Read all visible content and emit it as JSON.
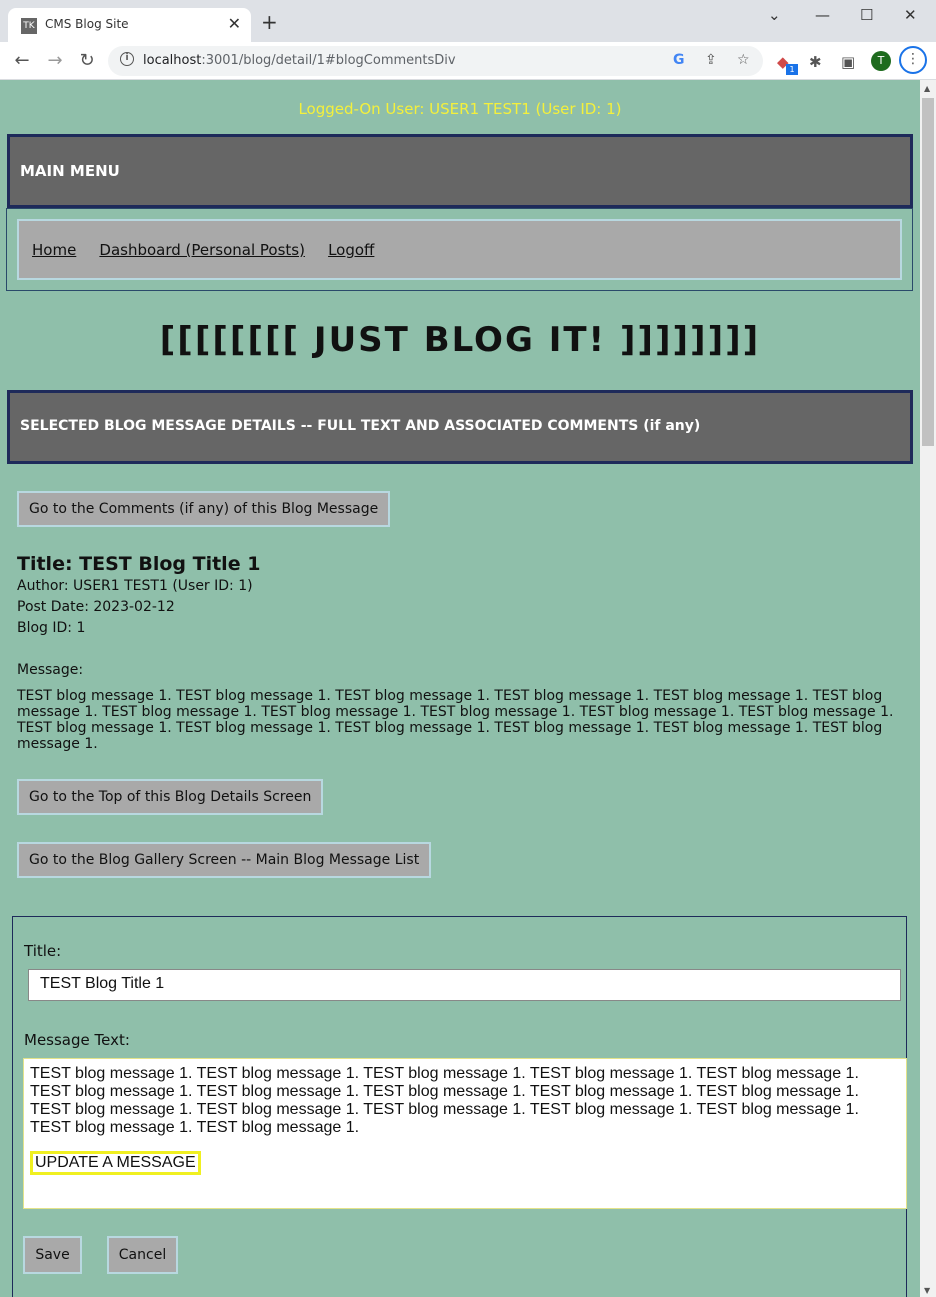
{
  "browser": {
    "tab_favicon": "TK",
    "tab_title": "CMS Blog Site",
    "tab_close": "✕",
    "new_tab": "+",
    "url_host": "localhost",
    "url_rest": ":3001/blog/detail/1#blogCommentsDiv",
    "window_minimize": "⌄",
    "profile_initial": "T",
    "extension_badge": "1"
  },
  "page": {
    "logged_user": "Logged-On User: USER1 TEST1 (User ID: 1)",
    "main_menu": "MAIN MENU",
    "nav": [
      {
        "label": "Home"
      },
      {
        "label": "Dashboard (Personal Posts)"
      },
      {
        "label": "Logoff"
      }
    ],
    "site_title": "[[[[[[[[   JUST   BLOG IT!   ]]]]]]]]",
    "detail_header": "SELECTED BLOG MESSAGE DETAILS -- FULL TEXT AND ASSOCIATED COMMENTS (if any)",
    "btn_comments": "Go to the Comments (if any) of this Blog Message",
    "blog_title": "Title: TEST Blog Title 1",
    "author": "Author: USER1 TEST1 (User ID: 1)",
    "post_date": "Post Date: 2023-02-12",
    "blog_id": "Blog ID: 1",
    "message_label": "Message:",
    "message_text": "TEST blog message 1. TEST blog message 1. TEST blog message 1. TEST blog message 1. TEST blog message 1. TEST blog message 1. TEST blog message 1. TEST blog message 1. TEST blog message 1. TEST blog message 1. TEST blog message 1. TEST blog message 1. TEST blog message 1. TEST blog message 1. TEST blog message 1. TEST blog message 1. TEST blog message 1.",
    "btn_top": "Go to the Top of this Blog Details Screen",
    "btn_gallery": "Go to the Blog Gallery Screen -- Main Blog Message List",
    "form": {
      "title_label": "Title:",
      "title_value": "TEST Blog Title 1",
      "message_label": "Message Text:",
      "message_value": "TEST blog message 1. TEST blog message 1. TEST blog message 1. TEST blog message 1. TEST blog message 1. TEST blog message 1. TEST blog message 1. TEST blog message 1. TEST blog message 1. TEST blog message 1. TEST blog message 1. TEST blog message 1. TEST blog message 1. TEST blog message 1. TEST blog message 1. TEST blog message 1. TEST blog message 1.",
      "update_tag": "UPDATE A MESSAGE",
      "save": "Save",
      "cancel": "Cancel"
    }
  }
}
